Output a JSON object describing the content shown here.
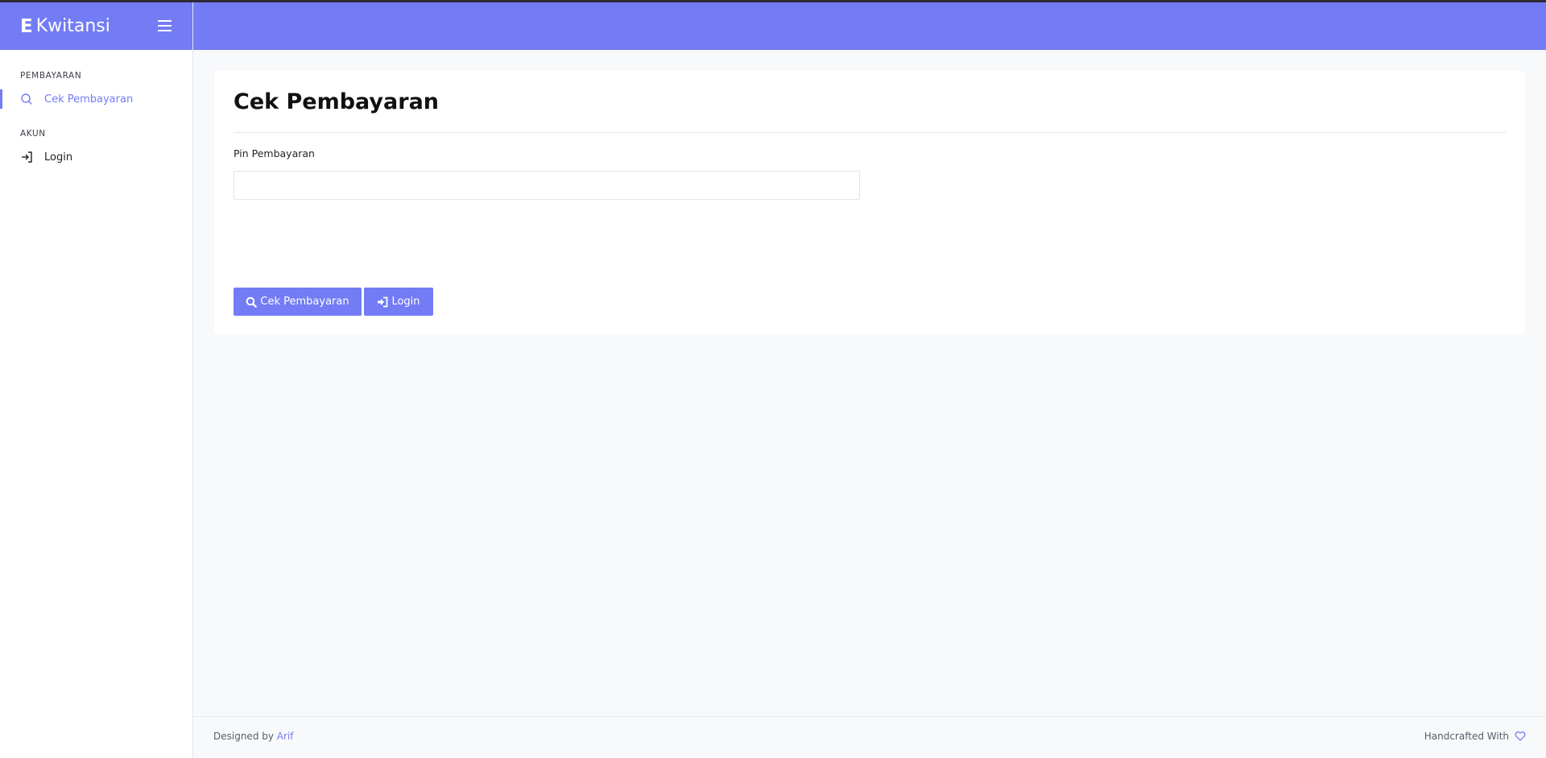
{
  "brand": {
    "initial": "E",
    "name": "Kwitansi"
  },
  "sidebar": {
    "sections": [
      {
        "title": "PEMBAYARAN",
        "items": [
          {
            "label": "Cek Pembayaran",
            "icon": "search-icon",
            "active": true
          }
        ]
      },
      {
        "title": "AKUN",
        "items": [
          {
            "label": "Login",
            "icon": "login-icon",
            "active": false
          }
        ]
      }
    ]
  },
  "main": {
    "title": "Cek Pembayaran",
    "field_label": "Pin Pembayaran",
    "field_value": "",
    "field_placeholder": "",
    "buttons": {
      "check": "Cek Pembayaran",
      "login": "Login"
    }
  },
  "footer": {
    "designed_by": "Designed by",
    "author": "Arif",
    "handcrafted": "Handcrafted With"
  },
  "colors": {
    "accent": "#737cf5",
    "top_strip": "#2d2a3a",
    "background": "#f8f9fb"
  }
}
